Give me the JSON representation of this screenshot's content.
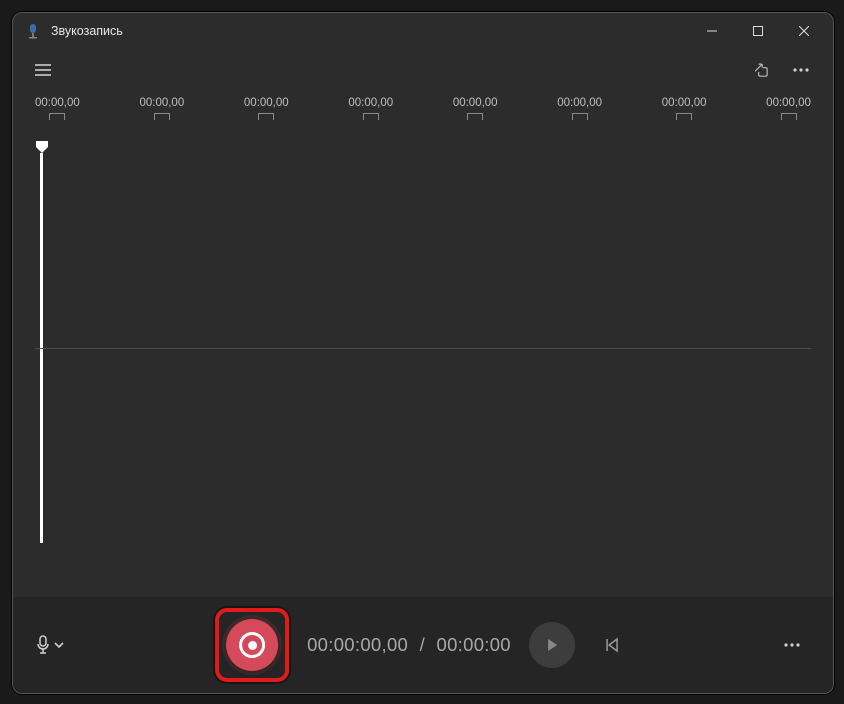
{
  "app": {
    "title": "Звукозапись"
  },
  "ruler": {
    "ticks": [
      "00:00,00",
      "00:00,00",
      "00:00,00",
      "00:00,00",
      "00:00,00",
      "00:00,00",
      "00:00,00",
      "00:00,00"
    ]
  },
  "time": {
    "current": "00:00:00,00",
    "separator": "/",
    "total": "00:00:00"
  },
  "icons": {
    "mic": "mic-icon",
    "chevron": "chevron-down-icon",
    "hamburger": "hamburger-icon",
    "share": "share-icon",
    "more": "more-icon",
    "minimize": "minimize-icon",
    "maximize": "maximize-icon",
    "close": "close-icon",
    "record": "record-icon",
    "play": "play-icon",
    "skip_prev": "skip-previous-icon"
  }
}
